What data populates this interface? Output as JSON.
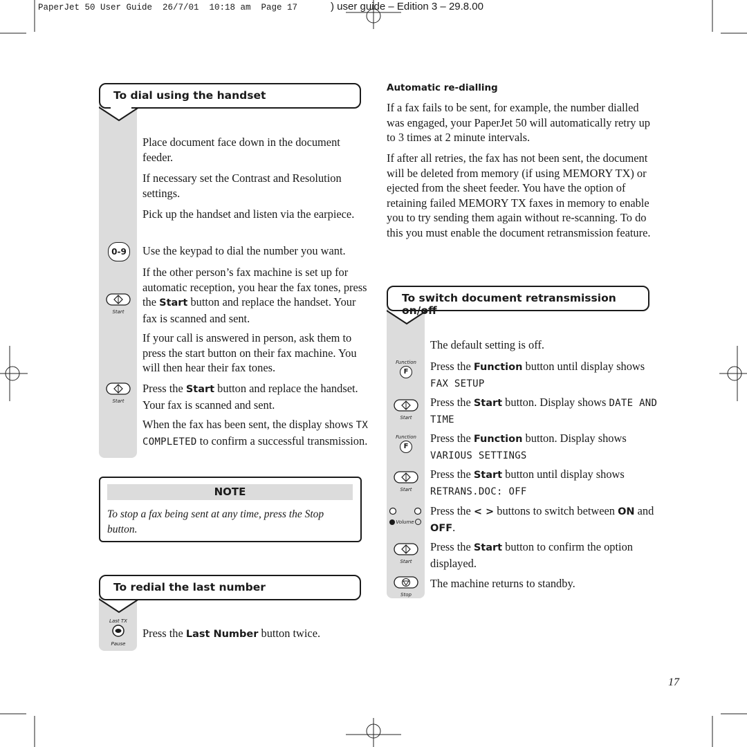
{
  "slug": {
    "meta": "PaperJet 50 User Guide  26/7/01  10:18 am  Page 17",
    "edition": ") user guide – Edition 3 – 29.8.00"
  },
  "left": {
    "title": "To dial using the handset",
    "paragraphs": [
      [
        {
          "t": "Place document face down in the document feeder."
        }
      ],
      [
        {
          "t": "If necessary set the Contrast and Resolution settings."
        }
      ],
      [
        {
          "t": "Pick up the handset and listen via the earpiece."
        }
      ],
      [
        {
          "t": "Use the keypad to dial the number you want."
        }
      ],
      [
        {
          "t": "If the other person’s fax machine is set up for automatic reception, you hear the fax tones, press the "
        },
        {
          "t": "Start",
          "s": "b"
        },
        {
          "t": " button and replace the handset. Your fax is scanned and sent."
        }
      ],
      [
        {
          "t": "If your call is answered in person, ask them to press the start button on their fax machine. You will then hear their fax tones."
        }
      ],
      [
        {
          "t": "Press the "
        },
        {
          "t": "Start",
          "s": "b"
        },
        {
          "t": " button and replace the handset. Your fax is scanned and sent."
        }
      ],
      [
        {
          "t": "When the fax has been sent, the display shows "
        },
        {
          "t": "TX COMPLETED",
          "s": "m"
        },
        {
          "t": " to confirm a successful transmission."
        }
      ]
    ],
    "keypad_label": "0-9",
    "start_label": "Start"
  },
  "note": {
    "heading": "NOTE",
    "text": "To stop a fax being sent at any time, press the Stop button."
  },
  "redial": {
    "title": "To redial the last number",
    "icon_top": "Last TX",
    "icon_bottom": "Pause",
    "paragraph": [
      {
        "t": "Press the "
      },
      {
        "t": "Last Number",
        "s": "b"
      },
      {
        "t": " button twice."
      }
    ]
  },
  "right": {
    "subheading": "Automatic re-dialling",
    "paragraphs": [
      [
        {
          "t": "If a fax fails to be sent, for example, the number dialled was engaged, your PaperJet 50 will automatically retry up to 3 times at 2 minute intervals."
        }
      ],
      [
        {
          "t": "If after all retries, the fax has not been sent, the document will be deleted from memory (if using MEMORY TX) or ejected from the sheet feeder. You have the option of retaining failed MEMORY TX faxes in memory to enable you to try sending them again without re-scanning. To do this you must enable the document retransmission feature."
        }
      ]
    ],
    "title": "To switch document retransmission on/off",
    "steps": [
      [
        {
          "t": "The default setting is off."
        }
      ],
      [
        {
          "t": "Press the "
        },
        {
          "t": "Function",
          "s": "b"
        },
        {
          "t": " button until display shows "
        },
        {
          "t": "FAX SETUP",
          "s": "m"
        }
      ],
      [
        {
          "t": "Press the "
        },
        {
          "t": "Start",
          "s": "b"
        },
        {
          "t": " button. Display shows "
        },
        {
          "t": "DATE AND TIME",
          "s": "m"
        }
      ],
      [
        {
          "t": "Press the "
        },
        {
          "t": "Function",
          "s": "b"
        },
        {
          "t": " button. Display shows "
        },
        {
          "t": "VARIOUS SETTINGS",
          "s": "m"
        }
      ],
      [
        {
          "t": "Press the "
        },
        {
          "t": "Start",
          "s": "b"
        },
        {
          "t": " button until display shows "
        },
        {
          "t": "RETRANS.DOC: OFF",
          "s": "m"
        }
      ],
      [
        {
          "t": "Press the "
        },
        {
          "t": "< >",
          "s": "b"
        },
        {
          "t": " buttons to switch between "
        },
        {
          "t": "ON",
          "s": "b"
        },
        {
          "t": " and "
        },
        {
          "t": "OFF",
          "s": "b"
        },
        {
          "t": "."
        }
      ],
      [
        {
          "t": "Press the "
        },
        {
          "t": "Start",
          "s": "b"
        },
        {
          "t": " button to confirm the option displayed."
        }
      ],
      [
        {
          "t": "The machine returns to standby."
        }
      ]
    ],
    "function_label": "Function",
    "function_key": "F",
    "start_label": "Start",
    "stop_label": "Stop",
    "volume_label": "Volume"
  },
  "page_number": "17"
}
